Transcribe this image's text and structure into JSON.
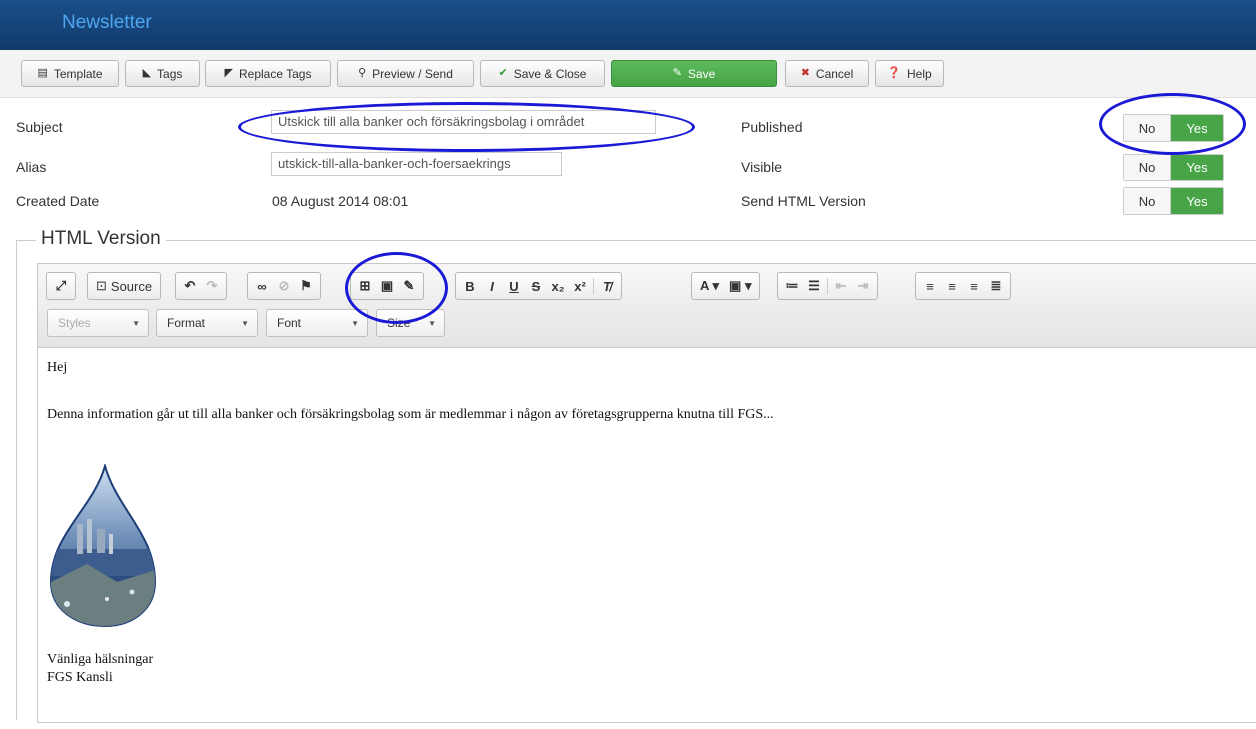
{
  "header": {
    "title": "Newsletter"
  },
  "toolbar": {
    "template": "Template",
    "tags": "Tags",
    "replace_tags": "Replace Tags",
    "preview_send": "Preview / Send",
    "save_close": "Save & Close",
    "save": "Save",
    "cancel": "Cancel",
    "help": "Help"
  },
  "form": {
    "subject_label": "Subject",
    "subject_value": "Utskick till alla banker och försäkringsbolag i området",
    "alias_label": "Alias",
    "alias_value": "utskick-till-alla-banker-och-foersaekrings",
    "created_label": "Created Date",
    "created_value": "08 August 2014 08:01",
    "published_label": "Published",
    "visible_label": "Visible",
    "send_html_label": "Send HTML Version",
    "no": "No",
    "yes": "Yes",
    "published": true,
    "visible": true,
    "send_html": true
  },
  "editor": {
    "legend": "HTML Version",
    "source_label": "Source",
    "combos": {
      "styles": "Styles",
      "format": "Format",
      "font": "Font",
      "size": "Size"
    },
    "content": {
      "greeting": "Hej",
      "body": "Denna information går ut till alla banker och försäkringsbolag som är medlemmar i någon av företagsgrupperna knutna till FGS...",
      "closing1": "Vänliga hälsningar",
      "closing2": "FGS Kansli"
    }
  },
  "colors": {
    "header": "#1a4f8a",
    "header_title": "#4ea6f0",
    "save_green": "#47a447",
    "annotation": "#1a1ad6"
  }
}
